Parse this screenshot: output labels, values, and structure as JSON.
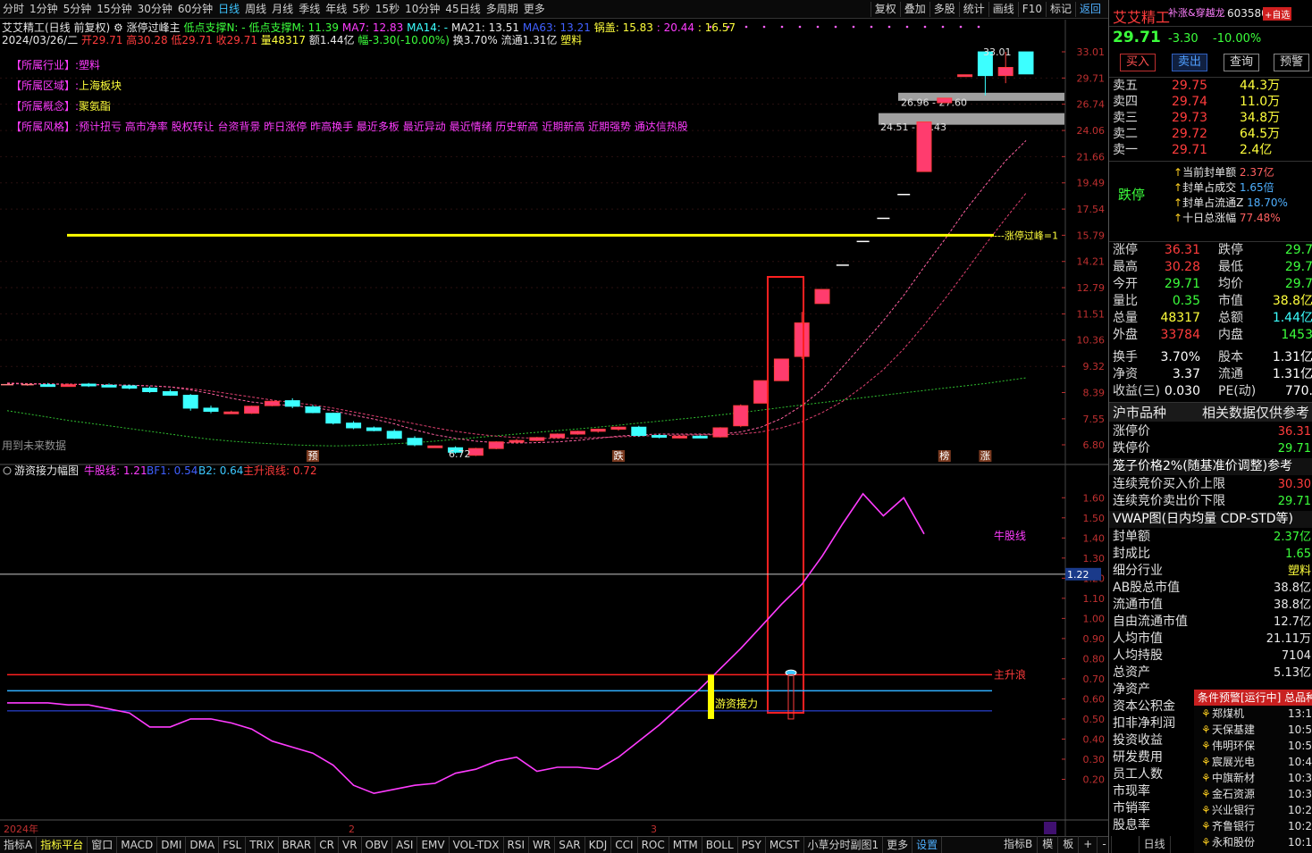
{
  "toolbar": {
    "left": [
      "分时",
      "1分钟",
      "5分钟",
      "15分钟",
      "30分钟",
      "60分钟",
      "日线",
      "周线",
      "月线",
      "季线",
      "年线",
      "5秒",
      "15秒",
      "10分钟",
      "45日线",
      "多周期",
      "更多"
    ],
    "selected_index": 6,
    "right": [
      "复权",
      "叠加",
      "多股",
      "统计",
      "画线",
      "F10",
      "标记",
      "返回"
    ]
  },
  "header": {
    "title": "艾艾精工(日线 前复权)",
    "indicator": "涨停过峰主",
    "low_support_n": "低点支撑N: -",
    "low_support_m": "低点支撑M: 11.39",
    "ma7": "MA7: 12.83",
    "ma14": "MA14: -",
    "ma21": "MA21: 13.51",
    "ma63": "MA63: 13.21",
    "guogai": "锅盖: 15.83",
    "v1": ": 20.44",
    "v2": ": 16.57"
  },
  "bar_info": {
    "date": "2024/03/26/二",
    "open": "开29.71",
    "high": "高30.28",
    "low": "低29.71",
    "close": "收29.71",
    "vol": "量48317",
    "amt": "额1.44亿",
    "chg": "幅-3.30(-10.00%)",
    "turn": "换3.70%",
    "float": "流通1.31亿",
    "sector": "塑料"
  },
  "tags": [
    {
      "label": "【所属行业】:",
      "value": "塑料"
    },
    {
      "label": "【所属区域】:",
      "value": "上海板块"
    },
    {
      "label": "【所属概念】:",
      "value": "聚氨酯"
    },
    {
      "label": "【所属风格】:",
      "value": "预计扭亏 高市净率 股权转让 台资背景 昨日涨停 昨高换手 最近多板 最近异动 最近情绪 历史新高 近期新高 近期强势 通达信热股"
    }
  ],
  "chart_data": [
    {
      "type": "candlestick",
      "name": "main",
      "y_scale": "log",
      "ylim": [
        6.8,
        33.01
      ],
      "y_ticks": [
        "33.01",
        "29.71",
        "26.74",
        "24.06",
        "21.66",
        "19.49",
        "17.54",
        "15.79",
        "14.21",
        "12.79",
        "11.51",
        "10.36",
        "9.32",
        "8.39",
        "7.55",
        "6.80"
      ],
      "candles": [
        [
          8.66,
          8.66,
          8.66,
          8.66
        ],
        [
          8.66,
          8.7,
          8.62,
          8.66
        ],
        [
          8.66,
          8.72,
          8.6,
          8.64
        ],
        [
          8.64,
          8.7,
          8.6,
          8.66
        ],
        [
          8.68,
          8.72,
          8.58,
          8.64
        ],
        [
          8.64,
          8.7,
          8.58,
          8.62
        ],
        [
          8.62,
          8.66,
          8.5,
          8.54
        ],
        [
          8.54,
          8.6,
          8.38,
          8.42
        ],
        [
          8.42,
          8.5,
          8.28,
          8.3
        ],
        [
          8.3,
          8.34,
          7.8,
          7.88
        ],
        [
          7.88,
          7.96,
          7.72,
          7.78
        ],
        [
          7.74,
          7.8,
          7.7,
          7.76
        ],
        [
          7.72,
          7.96,
          7.7,
          7.94
        ],
        [
          7.96,
          8.12,
          7.94,
          8.1
        ],
        [
          8.12,
          8.2,
          7.88,
          7.94
        ],
        [
          7.92,
          7.98,
          7.72,
          7.74
        ],
        [
          7.72,
          7.74,
          7.38,
          7.42
        ],
        [
          7.42,
          7.48,
          7.24,
          7.28
        ],
        [
          7.28,
          7.32,
          7.18,
          7.2
        ],
        [
          7.18,
          7.24,
          6.96,
          6.98
        ],
        [
          6.98,
          7.04,
          6.76,
          6.8
        ],
        [
          6.76,
          6.78,
          6.76,
          6.77
        ],
        [
          6.72,
          6.76,
          6.56,
          6.6
        ],
        [
          6.52,
          6.72,
          6.5,
          6.7
        ],
        [
          6.7,
          6.9,
          6.68,
          6.88
        ],
        [
          6.88,
          6.96,
          6.84,
          6.92
        ],
        [
          6.92,
          7.02,
          6.9,
          7.0
        ],
        [
          7.0,
          7.12,
          6.98,
          7.1
        ],
        [
          7.1,
          7.2,
          7.08,
          7.18
        ],
        [
          7.18,
          7.26,
          7.14,
          7.24
        ],
        [
          7.24,
          7.32,
          7.2,
          7.3
        ],
        [
          7.3,
          7.34,
          7.02,
          7.06
        ],
        [
          7.06,
          7.1,
          6.98,
          7.02
        ],
        [
          7.02,
          7.06,
          6.98,
          7.04
        ],
        [
          7.04,
          7.08,
          7.0,
          7.02
        ],
        [
          7.02,
          7.3,
          7.0,
          7.28
        ],
        [
          7.34,
          8.0,
          7.3,
          7.96
        ],
        [
          8.04,
          8.8,
          8.04,
          8.8
        ],
        [
          8.8,
          9.6,
          8.8,
          9.6
        ],
        [
          9.7,
          11.6,
          9.6,
          11.1
        ],
        [
          12.0,
          12.7,
          12.0,
          12.7
        ],
        [
          14.0,
          14.0,
          14.0,
          14.0
        ],
        [
          15.4,
          15.4,
          15.4,
          15.4
        ],
        [
          16.9,
          16.9,
          16.9,
          16.9
        ],
        [
          18.6,
          18.6,
          18.6,
          18.6
        ],
        [
          20.4,
          24.9,
          20.4,
          24.9
        ],
        [
          26.9,
          27.4,
          26.9,
          27.4
        ],
        [
          30.0,
          30.1,
          30.0,
          30.1
        ],
        [
          33.0,
          33.0,
          27.7,
          30.0
        ],
        [
          30.0,
          33.0,
          29.1,
          31.0
        ],
        [
          33.0,
          33.01,
          30.2,
          30.2
        ]
      ],
      "ma_fast": [
        8.7,
        8.68,
        8.68,
        8.67,
        8.66,
        8.65,
        8.64,
        8.62,
        8.58,
        8.48,
        8.35,
        8.2,
        8.08,
        8.0,
        7.96,
        7.9,
        7.8,
        7.66,
        7.54,
        7.4,
        7.22,
        7.08,
        6.98,
        6.9,
        6.86,
        6.85,
        6.86,
        6.88,
        6.92,
        6.98,
        7.04,
        7.08,
        7.1,
        7.1,
        7.1,
        7.1,
        7.16,
        7.3,
        7.56,
        7.96,
        8.5,
        9.3,
        10.2,
        11.2,
        12.4,
        13.9,
        15.5,
        17.4,
        19.3,
        21.3,
        23.1
      ],
      "ma_slow": [
        8.72,
        8.7,
        8.69,
        8.68,
        8.67,
        8.66,
        8.64,
        8.62,
        8.58,
        8.52,
        8.44,
        8.34,
        8.24,
        8.14,
        8.06,
        7.98,
        7.88,
        7.76,
        7.64,
        7.52,
        7.4,
        7.28,
        7.18,
        7.1,
        7.04,
        7.0,
        6.98,
        6.98,
        6.99,
        7.0,
        7.02,
        7.04,
        7.06,
        7.07,
        7.08,
        7.08,
        7.1,
        7.16,
        7.28,
        7.46,
        7.74,
        8.1,
        8.6,
        9.2,
        10.0,
        11.0,
        12.2,
        13.6,
        15.2,
        16.9,
        18.7
      ],
      "ma_long": [
        7.8,
        7.7,
        7.6,
        7.5,
        7.42,
        7.34,
        7.26,
        7.18,
        7.1,
        7.02,
        6.95,
        6.9,
        6.86,
        6.83,
        6.8,
        6.78,
        6.77,
        6.78,
        6.8,
        6.83,
        6.86,
        6.9,
        6.95,
        7.0,
        7.05,
        7.1,
        7.15,
        7.2,
        7.25,
        7.3,
        7.36,
        7.42,
        7.48,
        7.54,
        7.6,
        7.67,
        7.74,
        7.82,
        7.9,
        7.98,
        8.06,
        8.14,
        8.22,
        8.3,
        8.38,
        8.46,
        8.54,
        8.62,
        8.7,
        8.8,
        8.9
      ],
      "peak_line": 15.79,
      "peak_label": "---涨停过峰=1",
      "annotations": [
        "33.01",
        "26.96 - 27.60",
        "24.51 - 25.43",
        "6.72"
      ],
      "markers": [
        {
          "i": 15,
          "label": "预"
        },
        {
          "i": 30,
          "label": "跌"
        },
        {
          "i": 46,
          "label": "榜"
        },
        {
          "i": 48,
          "label": "涨"
        }
      ],
      "future_label": "用到未来数据"
    },
    {
      "type": "line",
      "name": "sub",
      "legend": {
        "title": "游资接力幅图",
        "s1": "牛股线: 1.21",
        "s2": "BF1: 0.54",
        "s3": "B2: 0.64",
        "s4": "主升浪线: 0.72"
      },
      "ylim": [
        0.1,
        1.65
      ],
      "y_ticks": [
        "1.60",
        "1.50",
        "1.40",
        "1.30",
        "1.20",
        "1.10",
        "1.00",
        "0.90",
        "0.80",
        "0.70",
        "0.60",
        "0.50",
        "0.40",
        "0.30",
        "0.20"
      ],
      "current": "1.22",
      "niu_x": [
        0,
        1,
        2,
        3,
        4,
        5,
        6,
        7,
        8,
        9,
        10,
        11,
        12,
        13,
        14,
        15,
        16,
        17,
        18,
        19,
        20,
        21,
        22,
        23,
        24,
        25,
        26,
        27,
        28,
        29,
        30,
        31,
        32,
        33,
        34,
        35,
        36,
        37,
        38,
        39,
        40,
        41,
        42,
        43,
        44,
        45,
        46,
        47,
        48,
        49
      ],
      "niu": [
        0.58,
        0.58,
        0.58,
        0.57,
        0.57,
        0.55,
        0.53,
        0.46,
        0.46,
        0.5,
        0.5,
        0.48,
        0.45,
        0.39,
        0.36,
        0.33,
        0.27,
        0.17,
        0.13,
        0.15,
        0.17,
        0.18,
        0.23,
        0.25,
        0.29,
        0.31,
        0.24,
        0.26,
        0.26,
        0.25,
        0.31,
        0.39,
        0.47,
        0.56,
        0.65,
        0.75,
        0.85,
        0.96,
        1.07,
        1.17,
        1.31,
        1.47,
        1.62,
        1.51,
        1.6,
        1.42
      ],
      "main_line": 0.72,
      "b2": 0.64,
      "bf1": 0.54,
      "label_niu": "牛股线",
      "label_main": "主升浪",
      "label_relay": "游资接力"
    }
  ],
  "axis": {
    "year": "2024年",
    "m2": "2",
    "m3": "3"
  },
  "bottombar": [
    "指标A",
    "指标平台",
    "窗口",
    "MACD",
    "DMI",
    "DMA",
    "FSL",
    "TRIX",
    "BRAR",
    "CR",
    "VR",
    "OBV",
    "ASI",
    "EMV",
    "VOL-TDX",
    "RSI",
    "WR",
    "SAR",
    "KDJ",
    "CCI",
    "ROC",
    "MTM",
    "BOLL",
    "PSY",
    "MCST",
    "小草分时副图1",
    "更多",
    "设置"
  ],
  "bottombar_right": [
    "指标B",
    "模",
    "板",
    "+",
    "-",
    "日线"
  ],
  "rp": {
    "name": "艾艾精工",
    "tag": "补涨&穿越龙",
    "code": "603580",
    "add": "+自选",
    "price": "29.71",
    "chg": "-3.30",
    "pct": "-10.00%",
    "buttons": [
      "买入",
      "卖出",
      "查询",
      "预警"
    ],
    "asks": [
      [
        "卖五",
        "29.75",
        "44.3万"
      ],
      [
        "卖四",
        "29.74",
        "11.0万"
      ],
      [
        "卖三",
        "29.73",
        "34.8万"
      ],
      [
        "卖二",
        "29.72",
        "64.5万"
      ],
      [
        "卖一",
        "29.71",
        "2.4亿"
      ]
    ],
    "limit": "跌停",
    "seal": [
      [
        "当前封单额",
        "2.37亿"
      ],
      [
        "封单占成交",
        "1.65倍"
      ],
      [
        "封单占流通Z",
        "18.70%"
      ],
      [
        "十日总涨幅",
        "77.48%"
      ]
    ],
    "quote": [
      [
        "涨停",
        "36.31",
        "跌停",
        "29.7"
      ],
      [
        "最高",
        "30.28",
        "最低",
        "29.7"
      ],
      [
        "今开",
        "29.71",
        "均价",
        "29.7"
      ],
      [
        "量比",
        "0.35",
        "市值",
        "38.8亿"
      ],
      [
        "总量",
        "48317",
        "总额",
        "1.44亿"
      ],
      [
        "外盘",
        "33784",
        "内盘",
        "1453"
      ],
      [
        "换手",
        "3.70%",
        "股本",
        "1.31亿"
      ],
      [
        "净资",
        "3.37",
        "流通",
        "1.31亿"
      ],
      [
        "收益(三)",
        "0.030",
        "PE(动)",
        "770."
      ]
    ],
    "hs": {
      "h1": "沪市品种",
      "h2": "相关数据仅供参考",
      "l1": "涨停价",
      "v1": "36.31",
      "l2": "跌停价",
      "v2": "29.71",
      "l3": "笼子价格2%(随基准价调整)参考",
      "l4": "连续竞价买入价上限",
      "v4": "30.30",
      "l5": "连续竞价卖出价下限",
      "v5": "29.71",
      "l6": "VWAP图(日内均量 CDP-STD等)"
    },
    "fund": [
      [
        "封单额",
        "2.37亿"
      ],
      [
        "封成比",
        "1.65"
      ],
      [
        "细分行业",
        "塑料"
      ],
      [
        "AB股总市值",
        "38.8亿"
      ],
      [
        "流通市值",
        "38.8亿"
      ],
      [
        "自由流通市值",
        "12.7亿"
      ],
      [
        "人均市值",
        "21.11万"
      ],
      [
        "人均持股",
        "7104"
      ],
      [
        "总资产",
        "5.13亿"
      ],
      [
        "净资产",
        ""
      ],
      [
        "资本公积金",
        ""
      ],
      [
        "扣非净利润",
        ""
      ],
      [
        "投资收益",
        ""
      ],
      [
        "研发费用",
        ""
      ],
      [
        "员工人数",
        ""
      ],
      [
        "市现率",
        ""
      ],
      [
        "市销率",
        ""
      ],
      [
        "股息率",
        ""
      ]
    ],
    "alerts_title": "条件预警[运行中] 总品种",
    "alerts": [
      [
        "郑煤机",
        "13:1"
      ],
      [
        "天保基建",
        "10:5"
      ],
      [
        "伟明环保",
        "10:5"
      ],
      [
        "宸展光电",
        "10:4"
      ],
      [
        "中旗新材",
        "10:3"
      ],
      [
        "金石资源",
        "10:3"
      ],
      [
        "兴业银行",
        "10:2"
      ],
      [
        "齐鲁银行",
        "10:2"
      ],
      [
        "永和股份",
        "10:1"
      ]
    ]
  }
}
